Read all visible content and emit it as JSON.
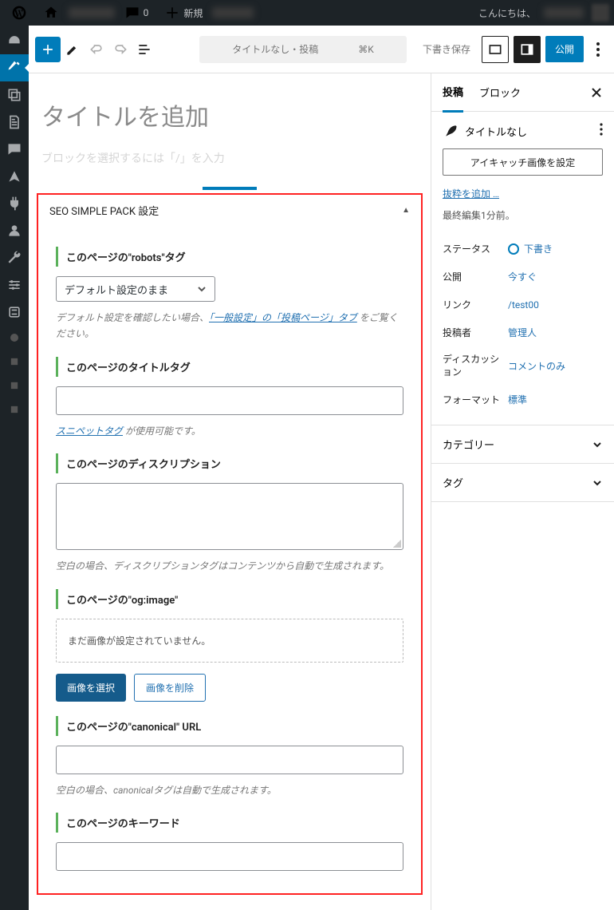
{
  "adminBar": {
    "commentsCount": "0",
    "newLabel": "新規",
    "greeting": "こんにちは、"
  },
  "editorHeader": {
    "cmdTitle": "タイトルなし・投稿",
    "cmdKey": "⌘K",
    "saveDraft": "下書き保存",
    "publish": "公開"
  },
  "canvas": {
    "titlePlaceholder": "タイトルを追加",
    "blockHint": "ブロックを選択するには「/」を入力"
  },
  "seo": {
    "panelTitle": "SEO SIMPLE PACK 設定",
    "robotsLabel": "このページの\"robots\"タグ",
    "robotsValue": "デフォルト設定のまま",
    "robotsHelpPre": "デフォルト設定を確認したい場合、",
    "robotsHelpLink": "「一般設定」の「投稿ページ」タブ",
    "robotsHelpPost": " をご覧ください。",
    "titleLabel": "このページのタイトルタグ",
    "titleHelpLink": "スニペットタグ",
    "titleHelpPost": " が使用可能です。",
    "descLabel": "このページのディスクリプション",
    "descHelp": "空白の場合、ディスクリプションタグはコンテンツから自動で生成されます。",
    "ogLabel": "このページの\"og:image\"",
    "ogEmpty": "まだ画像が設定されていません。",
    "btnSelect": "画像を選択",
    "btnRemove": "画像を削除",
    "canonicalLabel": "このページの\"canonical\" URL",
    "canonicalHelp": "空白の場合、canonicalタグは自動で生成されます。",
    "keywordLabel": "このページのキーワード"
  },
  "sidebar": {
    "tabPost": "投稿",
    "tabBlock": "ブロック",
    "docTitle": "タイトルなし",
    "setFeatured": "アイキャッチ画像を設定",
    "addExcerpt": "抜粋を追加 …",
    "lastEdit": "最終編集1分前。",
    "rows": {
      "statusK": "ステータス",
      "statusV": "下書き",
      "publishK": "公開",
      "publishV": "今すぐ",
      "linkK": "リンク",
      "linkV": "/test00",
      "authorK": "投稿者",
      "authorV": "管理人",
      "discK": "ディスカッション",
      "discV": "コメントのみ",
      "formatK": "フォーマット",
      "formatV": "標準"
    },
    "catLabel": "カテゴリー",
    "tagLabel": "タグ"
  }
}
